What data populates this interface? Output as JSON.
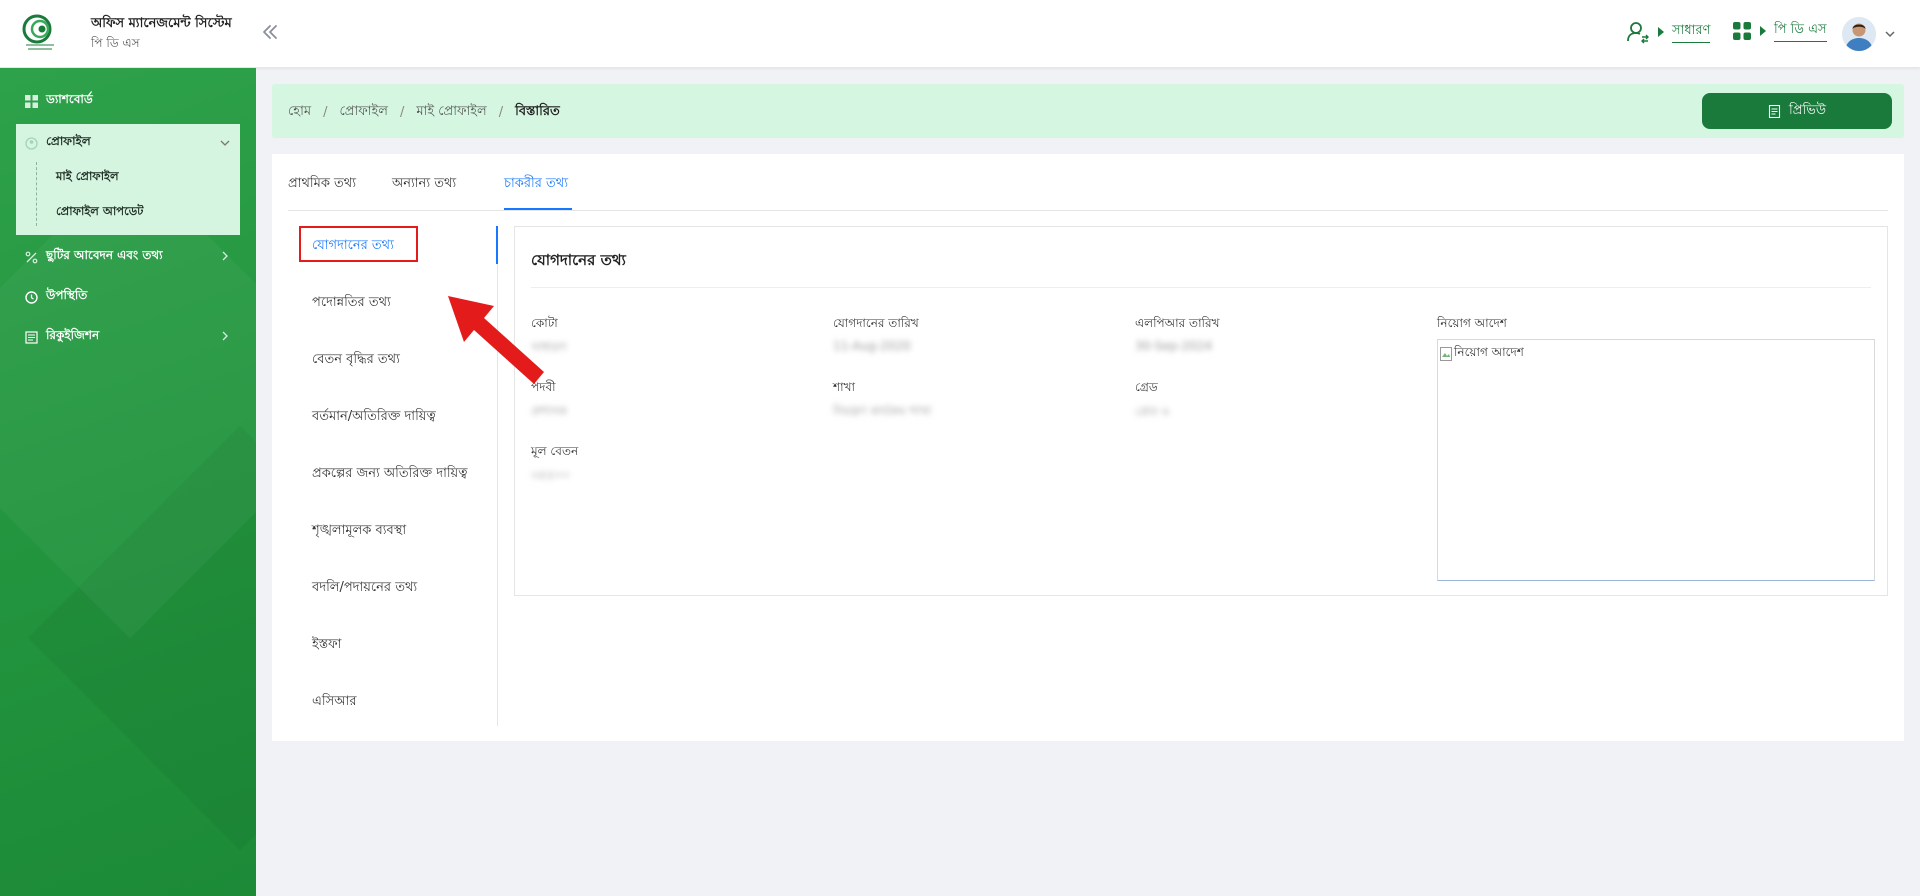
{
  "header": {
    "title": "অফিস ম্যানেজমেন্ট সিস্টেম",
    "subtitle": "পি ডি এস",
    "role_label": "সাধারণ",
    "app_label": "পি ডি এস"
  },
  "sidebar": {
    "items": [
      {
        "label": "ড্যাশবোর্ড",
        "icon": "grid-icon"
      },
      {
        "label": "প্রোফাইল",
        "icon": "user-circle-icon",
        "expanded": true
      },
      {
        "label": "ছুটির আবেদন এবং তথ্য",
        "icon": "percent-icon"
      },
      {
        "label": "উপস্থিতি",
        "icon": "clock-icon"
      },
      {
        "label": "রিকুইজিশন",
        "icon": "document-list-icon"
      }
    ],
    "profile_sub": [
      "মাই প্রোফাইল",
      "প্রোফাইল আপডেট"
    ]
  },
  "breadcrumb": [
    "হোম",
    "প্রোফাইল",
    "মাই প্রোফাইল",
    "বিস্তারিত"
  ],
  "preview_button": "প্রিভিউ",
  "tabs": [
    "প্রাথমিক তথ্য",
    "অন্যান্য তথ্য",
    "চাকরীর তথ্য"
  ],
  "active_tab": "চাকরীর তথ্য",
  "vertical_nav": [
    "যোগদানের তথ্য",
    "পদোন্নতির তথ্য",
    "বেতন বৃদ্ধির তথ্য",
    "বর্তমান/অতিরিক্ত দায়িত্ব",
    "প্রকল্পের জন্য অতিরিক্ত দায়িত্ব",
    "শৃঙ্খলামূলক ব্যবস্থা",
    "বদলি/পদায়নের তথ্য",
    "ইস্তফা",
    "এসিআর"
  ],
  "detail": {
    "title": "যোগদানের তথ্য",
    "fields": {
      "quota": {
        "label": "কোটা",
        "value": "সাধারণ"
      },
      "joining_date": {
        "label": "যোগদানের তারিখ",
        "value": "11-Aug-2020"
      },
      "lpr_date": {
        "label": "এলপিআর তারিখ",
        "value": "30-Sep-2024"
      },
      "appointment_order": {
        "label": "নিয়োগ আদেশ",
        "image_alt": "নিয়োগ আদেশ"
      },
      "designation": {
        "label": "পদবী",
        "value": "প্রশাসক"
      },
      "branch": {
        "label": "শাখা",
        "value": "নিয়ন্ত্রণ কার্যক্রম শাখা"
      },
      "grade": {
        "label": "গ্রেড",
        "value": "গ্রেড ৬"
      },
      "basic_salary": {
        "label": "মূল বেতন",
        "value": "৩৫৫০০"
      }
    }
  },
  "colors": {
    "brand_green": "#1a7a3c",
    "sidebar_green": "#249640",
    "active_blue": "#1677ff",
    "highlight_red": "#e31b1b"
  }
}
